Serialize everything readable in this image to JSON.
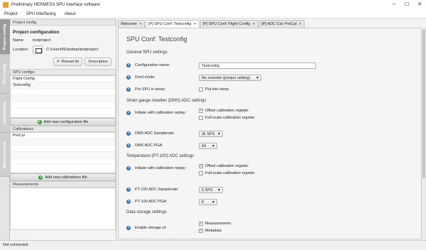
{
  "window": {
    "title": "Preliminary HERMESS SPU Interface software"
  },
  "menu": [
    "Project",
    "SPU Interfacing",
    "About"
  ],
  "side_tabs": [
    "Project config",
    "SPU config",
    "Calibrations",
    "Measurements"
  ],
  "project_config": {
    "header": "Project config",
    "title": "Project configuration",
    "name_label": "Name:",
    "name_value": "testproject",
    "location_label": "Location:",
    "location_value": "C:\\Users\\f\\Desktop\\testproject",
    "reload_label": "Reload dir",
    "description_label": "Description"
  },
  "spu_configs": {
    "header": "SPU configs",
    "items": [
      "Flight Config",
      "Testconfig"
    ],
    "add_label": "Add new configuration file"
  },
  "calibrations": {
    "header": "Calibrations",
    "items": [
      "PreCal"
    ],
    "add_label": "Add new calibrations file"
  },
  "measurements": {
    "header": "Measurements"
  },
  "tabs": [
    "Welcome",
    "[P] SPU Conf: Testconfig",
    "[P] SPU Conf: Flight Config",
    "[P] ADC Cal: PreCal"
  ],
  "content": {
    "title": "SPU Conf: Testconfig",
    "general_section": "General SPU settings",
    "config_name_label": "Configuration name:",
    "config_name_value": "Testconfig",
    "ovrd_label": "Ovrd mode:",
    "ovrd_value": "No override (jumper setting)",
    "sleep_label": "Put SPU in sleep:",
    "sleep_cb": "Put into sleep",
    "dms_section": "Strain gauge rosettes (DMS) ADC settings",
    "dms_init_label": "Initiate with calibration replay:",
    "dms_offset_cb": "Offset calibration register",
    "dms_fullscale_cb": "Full-scale calibration register",
    "dms_samplerate_label": "DMS ADC Samplerate:",
    "dms_samplerate_value": "2k SPS",
    "dms_pga_label": "DMS ADC PGA:",
    "dms_pga_value": "64",
    "pt_section": "Temperature (PT-100) ADC settings",
    "pt_init_label": "Initiate with calibration replay:",
    "pt_offset_cb": "Offset calibration register",
    "pt_fullscale_cb": "Full-scale calibration register",
    "pt_samplerate_label": "PT-100 ADC Samplerate:",
    "pt_samplerate_value": "5 SPS",
    "pt_pga_label": "PT-100 ADC PGA:",
    "pt_pga_value": "8",
    "storage_section": "Data storage settings",
    "storage_label": "Enable storage of:",
    "storage_meas_cb": "Measurements",
    "storage_meta_cb": "Metadata"
  },
  "status": "Not connected"
}
